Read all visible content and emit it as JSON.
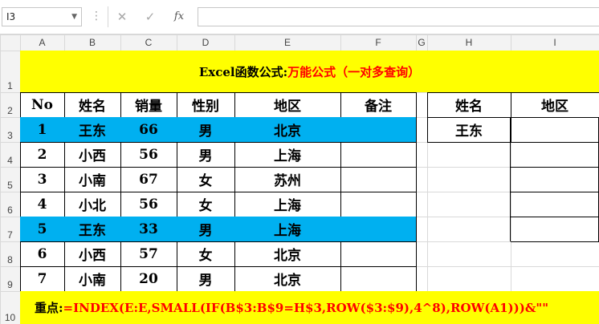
{
  "formula_bar": {
    "name_box": "I3",
    "cancel_icon": "✕",
    "enter_icon": "✓",
    "fx_label": "fx",
    "formula": ""
  },
  "columns": [
    "A",
    "B",
    "C",
    "D",
    "E",
    "F",
    "G",
    "H",
    "I"
  ],
  "rows": [
    "1",
    "2",
    "3",
    "4",
    "5",
    "6",
    "7",
    "8",
    "9",
    "10"
  ],
  "sheet": {
    "title_black": "Excel函数公式:",
    "title_red": "万能公式（一对多查询）",
    "headers": [
      "No",
      "姓名",
      "销量",
      "性别",
      "地区",
      "备注"
    ],
    "data": [
      [
        "1",
        "王东",
        "66",
        "男",
        "北京",
        ""
      ],
      [
        "2",
        "小西",
        "56",
        "男",
        "上海",
        ""
      ],
      [
        "3",
        "小南",
        "67",
        "女",
        "苏州",
        ""
      ],
      [
        "4",
        "小北",
        "56",
        "女",
        "上海",
        ""
      ],
      [
        "5",
        "王东",
        "33",
        "男",
        "上海",
        ""
      ],
      [
        "6",
        "小西",
        "57",
        "女",
        "北京",
        ""
      ],
      [
        "7",
        "小南",
        "20",
        "男",
        "北京",
        ""
      ]
    ],
    "lookup_headers": [
      "姓名",
      "地区"
    ],
    "lookup_name": "王东",
    "note_black": "重点:",
    "note_red": "=INDEX(E:E,SMALL(IF(B$3:B$9=H$3,ROW($3:$9),4^8),ROW(A1)))&\"\""
  },
  "colors": {
    "highlight_blue": "#00b0f0",
    "highlight_yellow": "#ffff00",
    "accent_red": "#ff0000"
  }
}
